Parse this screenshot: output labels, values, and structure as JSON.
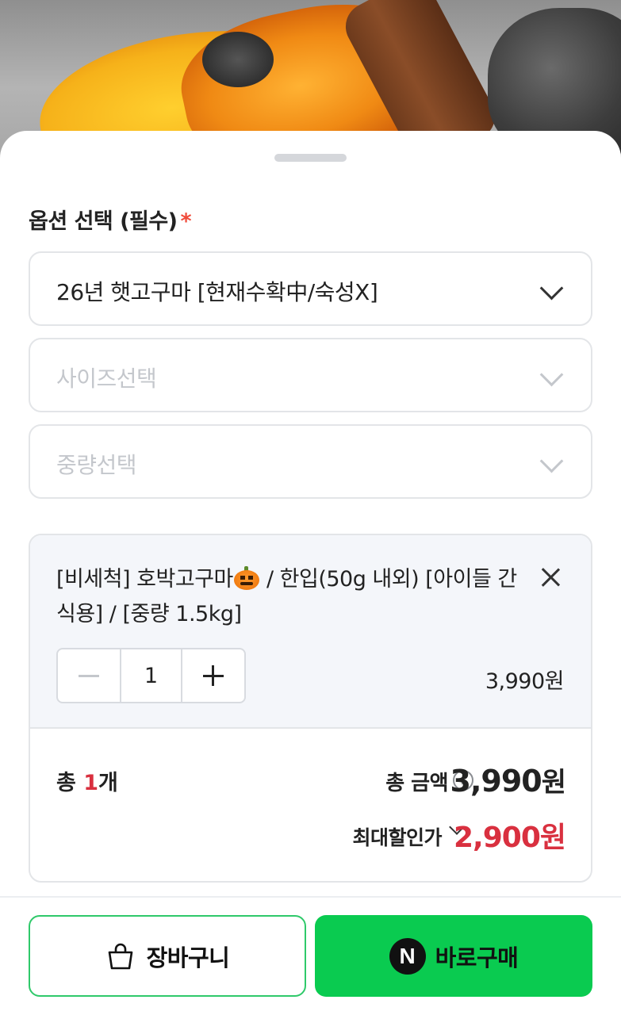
{
  "option_section": {
    "title": "옵션 선택 (필수)",
    "required_mark": "*"
  },
  "selects": [
    {
      "value": "26년 햇고구마 [현재수확中/숙성X]",
      "is_placeholder": false
    },
    {
      "value": "사이즈선택",
      "is_placeholder": true
    },
    {
      "value": "중량선택",
      "is_placeholder": true
    }
  ],
  "selected_item": {
    "name_part1": "[비세척] 호박고구마",
    "emoji": "jack-o-lantern-icon",
    "name_part2": " / 한입(50g 내외) [아이들 간식용] / [중량 1.5kg]",
    "quantity": "1",
    "price": "3,990원"
  },
  "summary": {
    "count_prefix": "총 ",
    "count_number": "1",
    "count_suffix": "개",
    "total_label": "총 금액",
    "info_glyph": "i",
    "total_amount": "3,990",
    "total_unit": "원",
    "discount_label": "최대할인가",
    "discount_amount": "2,900원"
  },
  "actions": {
    "cart_label": "장바구니",
    "npay_glyph": "N",
    "buy_label": "바로구매"
  },
  "colors": {
    "accent_green": "#0acb50",
    "required_red": "#f04b3a",
    "discount_red": "#d9303f"
  }
}
